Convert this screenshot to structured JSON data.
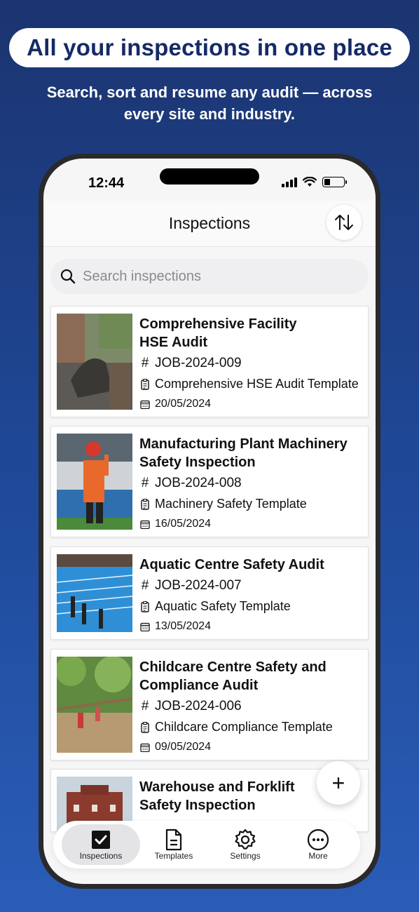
{
  "promo": {
    "headline": "All your inspections in one place",
    "subheadline": "Search, sort and resume any audit — across every site and industry."
  },
  "status_bar": {
    "time": "12:44"
  },
  "header": {
    "title": "Inspections",
    "sort_icon": "sort-arrows-icon"
  },
  "search": {
    "placeholder": "Search inspections",
    "icon": "search-icon"
  },
  "inspections": [
    {
      "title": "Comprehensive Facility HSE Audit",
      "job": "JOB-2024-009",
      "template": "Comprehensive HSE Audit Template",
      "date": "20/05/2024"
    },
    {
      "title": "Manufacturing Plant Machinery Safety Inspection",
      "job": "JOB-2024-008",
      "template": "Machinery Safety Template",
      "date": "16/05/2024"
    },
    {
      "title": "Aquatic Centre Safety Audit",
      "job": "JOB-2024-007",
      "template": "Aquatic Safety Template",
      "date": "13/05/2024"
    },
    {
      "title": "Childcare Centre Safety and Compliance Audit",
      "job": "JOB-2024-006",
      "template": "Childcare Compliance Template",
      "date": "09/05/2024"
    },
    {
      "title": "Warehouse and Forklift Safety Inspection"
    }
  ],
  "job_prefix": "#",
  "fab": {
    "label": "+"
  },
  "tabbar": {
    "items": [
      {
        "label": "Inspections",
        "icon": "checkbox-icon",
        "active": true
      },
      {
        "label": "Templates",
        "icon": "document-icon",
        "active": false
      },
      {
        "label": "Settings",
        "icon": "gear-icon",
        "active": false
      },
      {
        "label": "More",
        "icon": "more-dots-icon",
        "active": false
      }
    ]
  },
  "colors": {
    "background": "#1f4a9a",
    "headline": "#152a66",
    "accent": "#111111"
  }
}
